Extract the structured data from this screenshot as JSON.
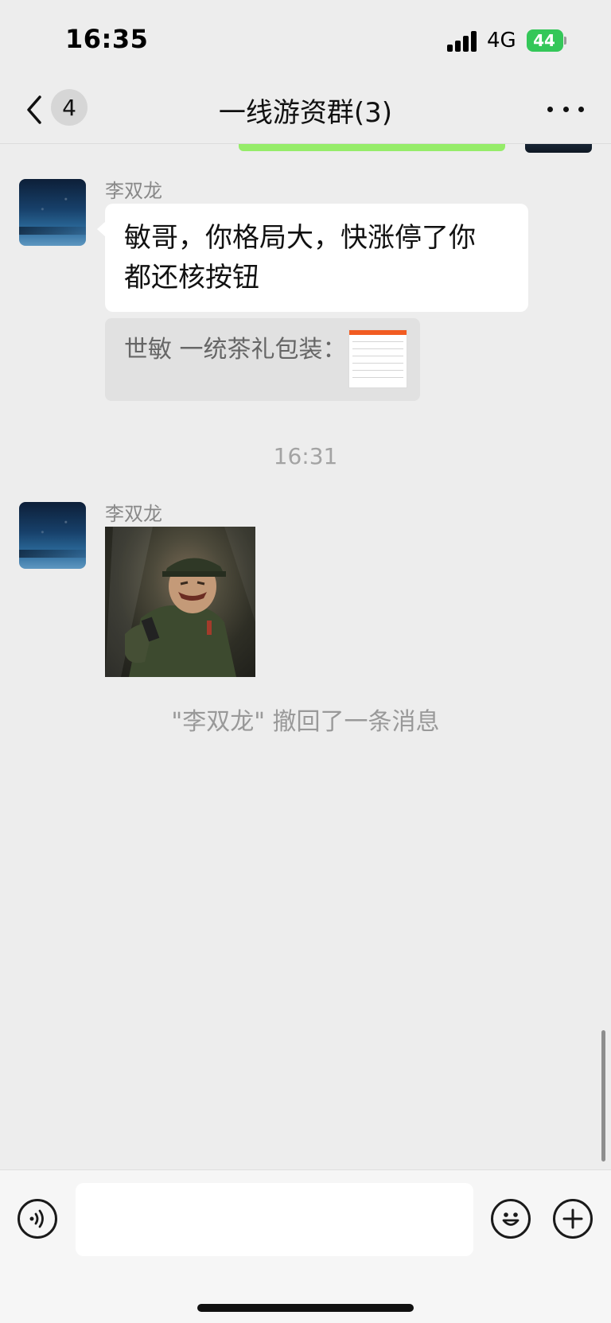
{
  "status_bar": {
    "time": "16:35",
    "network": "4G",
    "battery": "44"
  },
  "nav": {
    "unread_count": "4",
    "title": "一线游资群(3)"
  },
  "messages": [
    {
      "sender": "李双龙",
      "text_line1": "敏哥，你格局大，快涨停了你",
      "text_line2": "都还核按钮",
      "quote": "世敏 一统茶礼包装："
    },
    {
      "timestamp": "16:31",
      "sender": "李双龙",
      "content_type": "sticker"
    }
  ],
  "system_notice": "\"李双龙\" 撤回了一条消息",
  "input": {
    "placeholder": ""
  },
  "colors": {
    "background": "#ededed",
    "bubble_self": "#95ec69",
    "bubble_other": "#ffffff",
    "quote_bg": "#e1e1e1",
    "battery": "#34c759"
  },
  "icons": [
    "back-icon",
    "more-icon",
    "voice-icon",
    "emoji-icon",
    "plus-icon"
  ]
}
